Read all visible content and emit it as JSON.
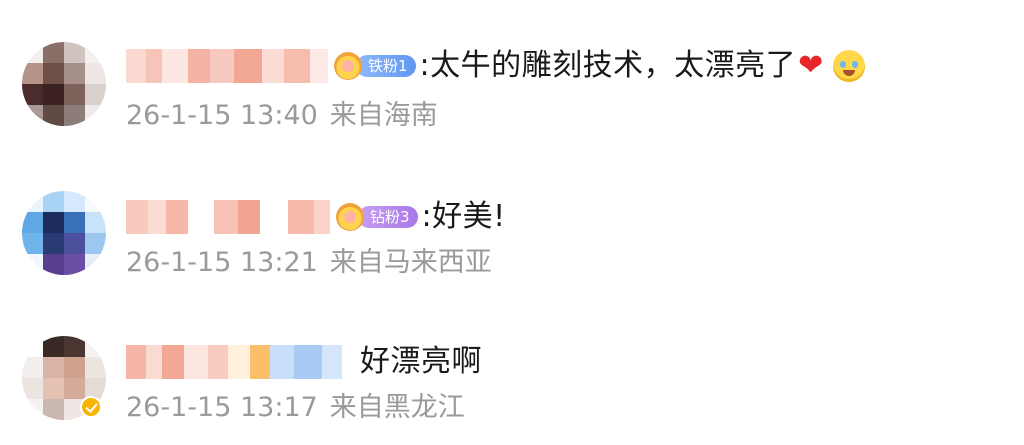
{
  "comments": [
    {
      "badge": "铁粉1",
      "text": ":太牛的雕刻技术，太漂亮了",
      "has_heart": true,
      "reaction_icon": "tears-of-joy-emoji-icon",
      "date": "26-1-15",
      "time": "13:40",
      "location": "来自海南"
    },
    {
      "badge": "钻粉3",
      "text": ":好美!",
      "date": "26-1-15",
      "time": "13:21",
      "location": "来自马来西亚"
    },
    {
      "text": "好漂亮啊",
      "verified": true,
      "date": "26-1-15",
      "time": "13:17",
      "location": "来自黑龙江"
    }
  ],
  "colors": {
    "text": "#1a1a1a",
    "meta": "#9a9a9a",
    "heart": "#e8262b",
    "badge_blue": "#5f97f2",
    "badge_purple": "#a877e8",
    "verified": "#f7b500"
  }
}
